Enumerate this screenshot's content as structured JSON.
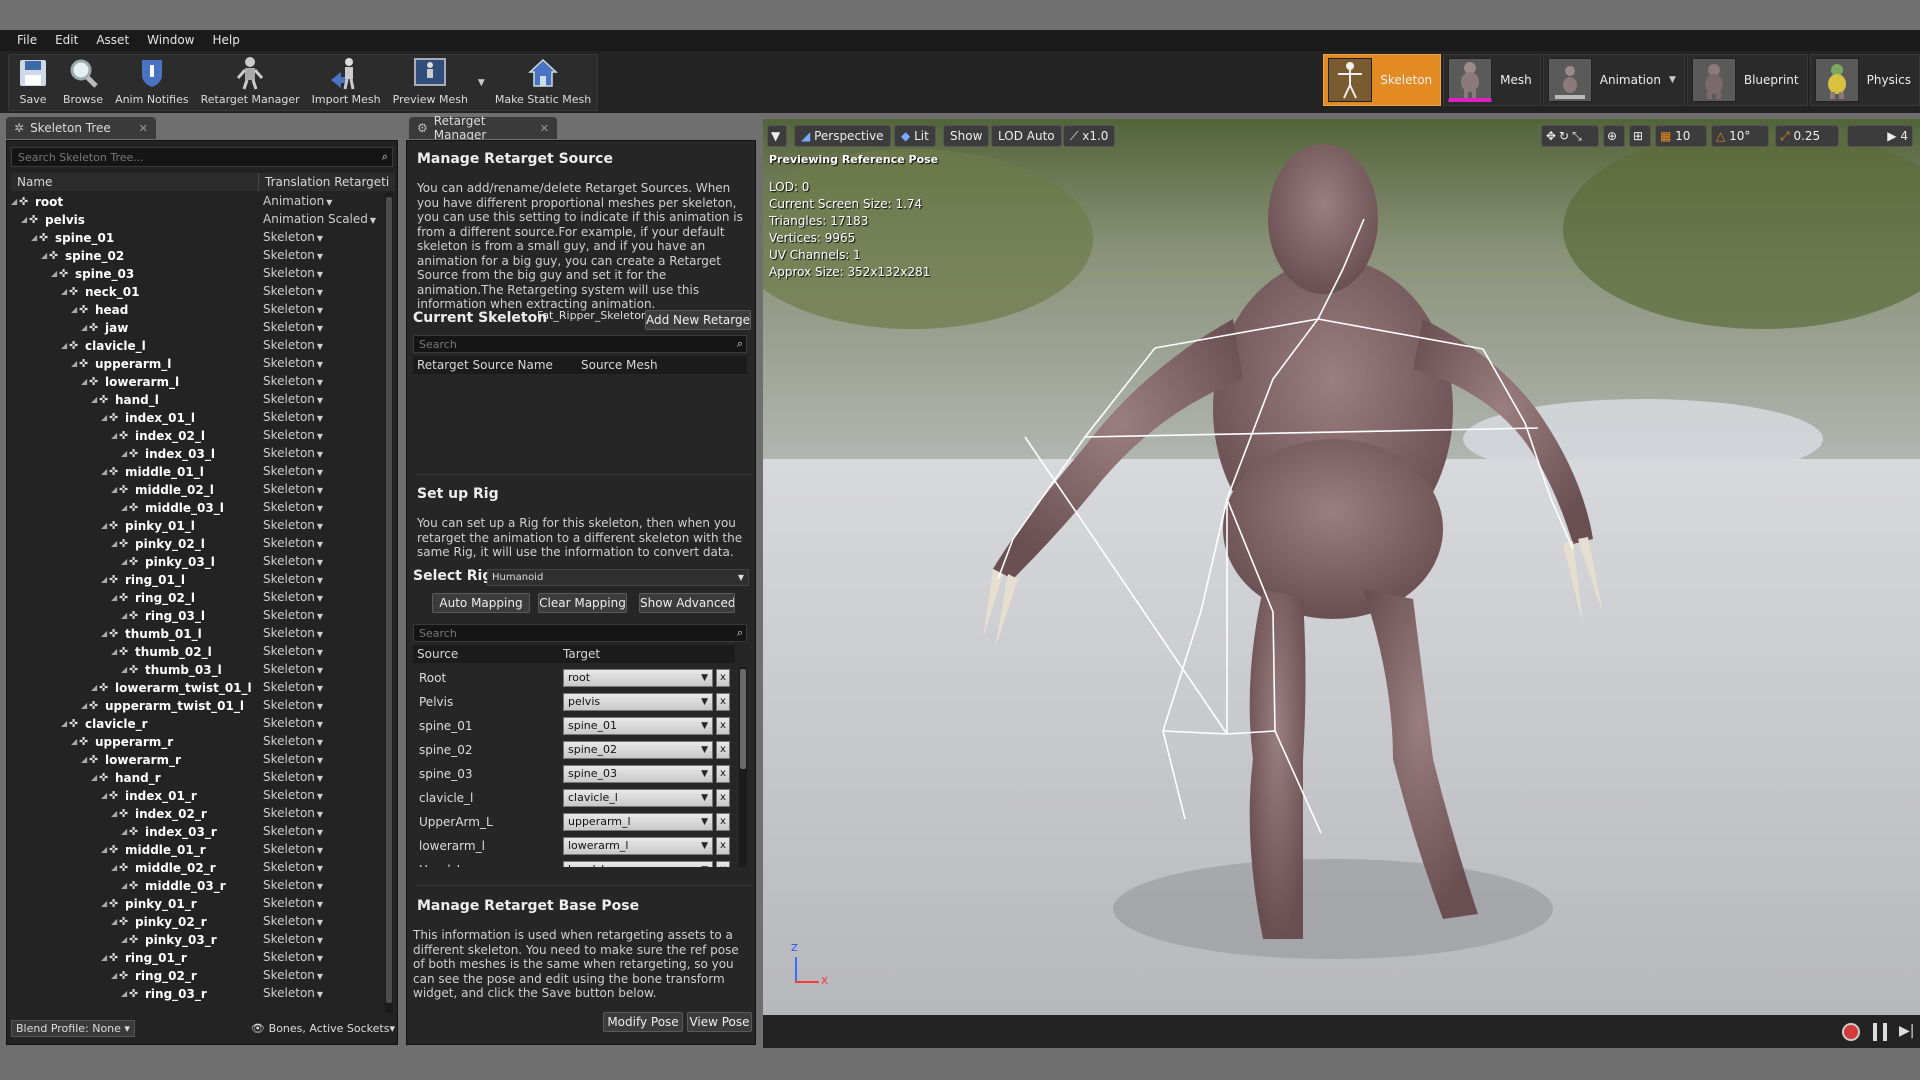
{
  "menu": [
    "File",
    "Edit",
    "Asset",
    "Window",
    "Help"
  ],
  "toolbar": {
    "save": "Save",
    "browse": "Browse",
    "anim_notifies": "Anim Notifies",
    "retarget_manager": "Retarget Manager",
    "import_mesh": "Import Mesh",
    "preview_mesh": "Preview Mesh",
    "make_static_mesh": "Make Static Mesh"
  },
  "modes": {
    "skeleton": "Skeleton",
    "mesh": "Mesh",
    "animation": "Animation",
    "blueprint": "Blueprint",
    "physics": "Physics"
  },
  "tabs": {
    "skeleton_tree": "Skeleton Tree",
    "retarget_manager": "Retarget Manager"
  },
  "skeleton_tree": {
    "search_placeholder": "Search Skeleton Tree...",
    "col_name": "Name",
    "col_translation": "Translation Retargeti",
    "bones": [
      {
        "name": "root",
        "depth": 0,
        "mode": "Animation"
      },
      {
        "name": "pelvis",
        "depth": 1,
        "mode": "Animation Scaled"
      },
      {
        "name": "spine_01",
        "depth": 2,
        "mode": "Skeleton"
      },
      {
        "name": "spine_02",
        "depth": 3,
        "mode": "Skeleton"
      },
      {
        "name": "spine_03",
        "depth": 4,
        "mode": "Skeleton"
      },
      {
        "name": "neck_01",
        "depth": 5,
        "mode": "Skeleton"
      },
      {
        "name": "head",
        "depth": 6,
        "mode": "Skeleton"
      },
      {
        "name": "jaw",
        "depth": 7,
        "mode": "Skeleton"
      },
      {
        "name": "clavicle_l",
        "depth": 5,
        "mode": "Skeleton"
      },
      {
        "name": "upperarm_l",
        "depth": 6,
        "mode": "Skeleton"
      },
      {
        "name": "lowerarm_l",
        "depth": 7,
        "mode": "Skeleton"
      },
      {
        "name": "hand_l",
        "depth": 8,
        "mode": "Skeleton"
      },
      {
        "name": "index_01_l",
        "depth": 9,
        "mode": "Skeleton"
      },
      {
        "name": "index_02_l",
        "depth": 10,
        "mode": "Skeleton"
      },
      {
        "name": "index_03_l",
        "depth": 11,
        "mode": "Skeleton"
      },
      {
        "name": "middle_01_l",
        "depth": 9,
        "mode": "Skeleton"
      },
      {
        "name": "middle_02_l",
        "depth": 10,
        "mode": "Skeleton"
      },
      {
        "name": "middle_03_l",
        "depth": 11,
        "mode": "Skeleton"
      },
      {
        "name": "pinky_01_l",
        "depth": 9,
        "mode": "Skeleton"
      },
      {
        "name": "pinky_02_l",
        "depth": 10,
        "mode": "Skeleton"
      },
      {
        "name": "pinky_03_l",
        "depth": 11,
        "mode": "Skeleton"
      },
      {
        "name": "ring_01_l",
        "depth": 9,
        "mode": "Skeleton"
      },
      {
        "name": "ring_02_l",
        "depth": 10,
        "mode": "Skeleton"
      },
      {
        "name": "ring_03_l",
        "depth": 11,
        "mode": "Skeleton"
      },
      {
        "name": "thumb_01_l",
        "depth": 9,
        "mode": "Skeleton"
      },
      {
        "name": "thumb_02_l",
        "depth": 10,
        "mode": "Skeleton"
      },
      {
        "name": "thumb_03_l",
        "depth": 11,
        "mode": "Skeleton"
      },
      {
        "name": "lowerarm_twist_01_l",
        "depth": 8,
        "mode": "Skeleton"
      },
      {
        "name": "upperarm_twist_01_l",
        "depth": 7,
        "mode": "Skeleton"
      },
      {
        "name": "clavicle_r",
        "depth": 5,
        "mode": "Skeleton"
      },
      {
        "name": "upperarm_r",
        "depth": 6,
        "mode": "Skeleton"
      },
      {
        "name": "lowerarm_r",
        "depth": 7,
        "mode": "Skeleton"
      },
      {
        "name": "hand_r",
        "depth": 8,
        "mode": "Skeleton"
      },
      {
        "name": "index_01_r",
        "depth": 9,
        "mode": "Skeleton"
      },
      {
        "name": "index_02_r",
        "depth": 10,
        "mode": "Skeleton"
      },
      {
        "name": "index_03_r",
        "depth": 11,
        "mode": "Skeleton"
      },
      {
        "name": "middle_01_r",
        "depth": 9,
        "mode": "Skeleton"
      },
      {
        "name": "middle_02_r",
        "depth": 10,
        "mode": "Skeleton"
      },
      {
        "name": "middle_03_r",
        "depth": 11,
        "mode": "Skeleton"
      },
      {
        "name": "pinky_01_r",
        "depth": 9,
        "mode": "Skeleton"
      },
      {
        "name": "pinky_02_r",
        "depth": 10,
        "mode": "Skeleton"
      },
      {
        "name": "pinky_03_r",
        "depth": 11,
        "mode": "Skeleton"
      },
      {
        "name": "ring_01_r",
        "depth": 9,
        "mode": "Skeleton"
      },
      {
        "name": "ring_02_r",
        "depth": 10,
        "mode": "Skeleton"
      },
      {
        "name": "ring_03_r",
        "depth": 11,
        "mode": "Skeleton"
      }
    ],
    "blend_profile": "Blend Profile: None",
    "bones_filter": "Bones, Active Sockets"
  },
  "retarget": {
    "source_title": "Manage Retarget Source",
    "source_text": "You can add/rename/delete Retarget Sources. When you have different proportional meshes per skeleton, you can use this setting to indicate if this animation is from a different source.For example, if your default skeleton is from a small guy, and if you have an animation for a big guy, you can create a Retarget Source from the big guy and set it for the animation.The Retargeting system will use this information when extracting animation.",
    "current_skeleton_label": "Current Skeleton",
    "current_skeleton_value": "Fat_Ripper_Skeleton",
    "add_new_button": "Add New Retarget",
    "search_placeholder": "Search",
    "col_source_name": "Retarget Source Name",
    "col_source_mesh": "Source Mesh",
    "rig_title": "Set up Rig",
    "rig_text": "You can set up a Rig for this skeleton, then when you retarget the animation to a different skeleton with the same Rig, it will use the information to convert data.",
    "select_rig_label": "Select Rig",
    "select_rig_value": "Humanoid",
    "auto_mapping": "Auto  Mapping",
    "clear_mapping": "Clear Mapping",
    "show_advanced": "Show Advanced",
    "map_search_placeholder": "Search",
    "col_source": "Source",
    "col_target": "Target",
    "mappings": [
      {
        "source": "Root",
        "target": "root"
      },
      {
        "source": "Pelvis",
        "target": "pelvis"
      },
      {
        "source": "spine_01",
        "target": "spine_01"
      },
      {
        "source": "spine_02",
        "target": "spine_02"
      },
      {
        "source": "spine_03",
        "target": "spine_03"
      },
      {
        "source": "clavicle_l",
        "target": "clavicle_l"
      },
      {
        "source": "UpperArm_L",
        "target": "upperarm_l"
      },
      {
        "source": "lowerarm_l",
        "target": "lowerarm_l"
      },
      {
        "source": "Hand_L",
        "target": "hand_l"
      }
    ],
    "clear_x": "x",
    "base_pose_title": "Manage Retarget Base Pose",
    "base_pose_text": "This information is used when retargeting assets to a different skeleton. You need to make sure the ref pose of both meshes is the same when retargeting, so you can see the pose and edit using the bone transform widget, and click the Save button below.",
    "modify_pose": "Modify Pose",
    "view_pose": "View Pose"
  },
  "viewport": {
    "perspective": "Perspective",
    "lit": "Lit",
    "show": "Show",
    "lod_auto": "LOD Auto",
    "speed": "x1.0",
    "grid_snap": "10",
    "rot_snap": "10°",
    "scale_snap": "0.25",
    "cam_speed": "4",
    "previewing": "Previewing Reference Pose",
    "info": [
      "LOD: 0",
      "Current Screen Size: 1.74",
      "Triangles: 17183",
      "Vertices: 9965",
      "UV Channels: 1",
      "Approx Size: 352x132x281"
    ],
    "axis_z": "Z",
    "axis_x": "X"
  },
  "colors": {
    "accent": "#e38b23",
    "panel": "#262626",
    "record": "#d33a3a"
  }
}
